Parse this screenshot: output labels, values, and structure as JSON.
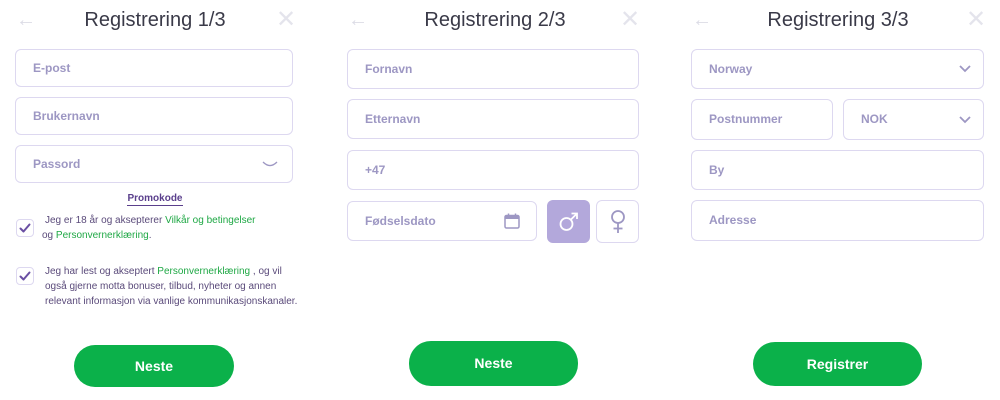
{
  "step1": {
    "title": "Registrering 1/3",
    "back_icon": "arrow-left-icon",
    "close_icon": "close-icon",
    "email_placeholder": "E-post",
    "username_placeholder": "Brukernavn",
    "password_placeholder": "Passord",
    "promo_label": "Promokode",
    "terms": {
      "pre": "Jeg er 18 år og aksepterer ",
      "link1": "Vilkår og betingelser",
      "mid": " og ",
      "link2": "Personvernerklæring",
      "post": "."
    },
    "privacy": {
      "pre": "Jeg har lest og akseptert ",
      "link": "Personvernerklæring",
      "post": " , og vil også gjerne motta bonuser, tilbud, nyheter og annen relevant informasjon via vanlige kommunikasjonskanaler."
    },
    "next_label": "Neste"
  },
  "step2": {
    "title": "Registrering 2/3",
    "firstname_placeholder": "Fornavn",
    "lastname_placeholder": "Etternavn",
    "phone_value": "+47",
    "birthdate_placeholder": "Fødselsdato",
    "male_icon": "male-icon",
    "female_icon": "female-icon",
    "next_label": "Neste"
  },
  "step3": {
    "title": "Registrering 3/3",
    "country_value": "Norway",
    "postcode_placeholder": "Postnummer",
    "currency_value": "NOK",
    "city_placeholder": "By",
    "address_placeholder": "Adresse",
    "register_label": "Registrer"
  },
  "colors": {
    "accent_green": "#0bb14a",
    "border": "#ddd8f0",
    "placeholder": "#9d97c3",
    "gender_selected": "#b3a8db"
  }
}
